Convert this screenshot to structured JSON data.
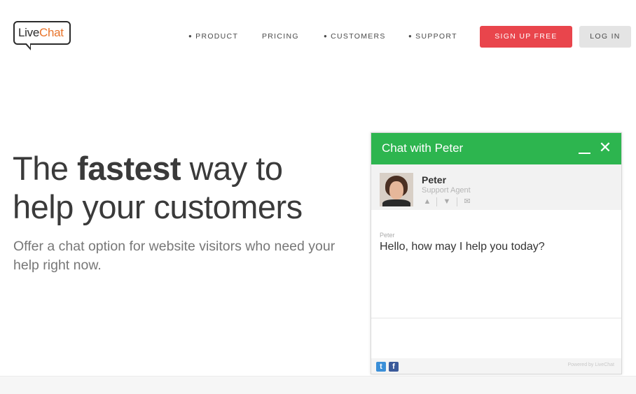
{
  "header": {
    "logo": {
      "part1": "Live",
      "part2": "Chat"
    },
    "nav": [
      {
        "label": "PRODUCT",
        "bullet": true
      },
      {
        "label": "PRICING",
        "bullet": false
      },
      {
        "label": "CUSTOMERS",
        "bullet": true
      },
      {
        "label": "SUPPORT",
        "bullet": true
      }
    ],
    "signup_label": "SIGN UP FREE",
    "login_label": "LOG IN"
  },
  "hero": {
    "title_pre": "The ",
    "title_bold": "fastest",
    "title_post": " way to",
    "title_line2": "help your customers",
    "subtitle": "Offer a chat option for website visitors who need your help right now."
  },
  "chat_widget": {
    "title": "Chat with Peter",
    "agent_name": "Peter",
    "agent_role": "Support Agent",
    "message_sender": "Peter",
    "message_text": "Hello, how may I help you today?",
    "powered_by": "Powered by LiveChat"
  },
  "colors": {
    "accent_green": "#2db54f",
    "signup_red": "#e9454c",
    "logo_orange": "#e8742b"
  }
}
